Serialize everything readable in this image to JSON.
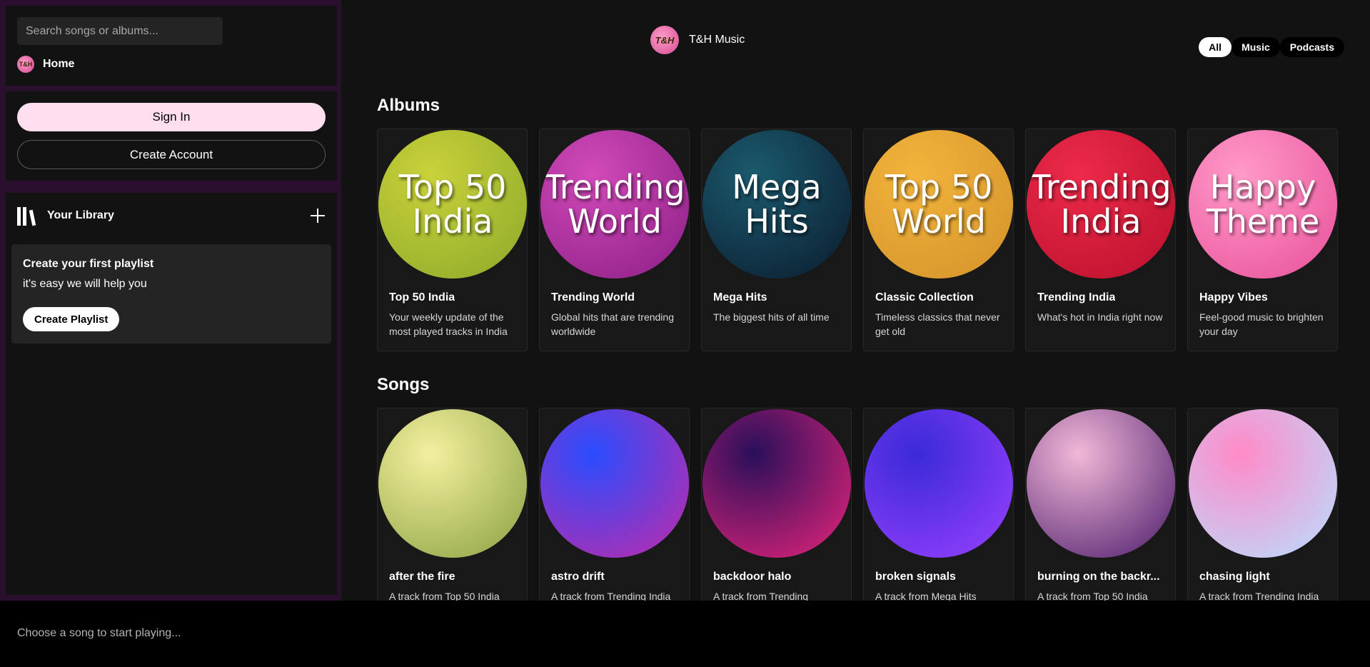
{
  "sidebar": {
    "search": {
      "placeholder": "Search songs or albums..."
    },
    "home": {
      "logo_text": "T&H",
      "label": "Home"
    },
    "auth": {
      "sign_in": "Sign In",
      "create_account": "Create Account"
    },
    "library": {
      "title": "Your Library",
      "card_title": "Create your first playlist",
      "card_sub": "it's easy we will help you",
      "create_playlist": "Create Playlist"
    }
  },
  "header": {
    "brand_logo_text": "T&H",
    "brand_name": "T&H Music",
    "filters": [
      "All",
      "Music",
      "Podcasts"
    ],
    "active_filter": "All"
  },
  "albums": {
    "title": "Albums",
    "items": [
      {
        "cover_text": "Top 50 India",
        "title": "Top 50 India",
        "desc": "Your weekly update of the most played tracks in India",
        "colors": [
          "#c9d23a",
          "#8ea82a"
        ]
      },
      {
        "cover_text": "Trending World",
        "title": "Trending World",
        "desc": "Global hits that are trending worldwide",
        "colors": [
          "#d24ab8",
          "#8a1e86"
        ]
      },
      {
        "cover_text": "Mega Hits",
        "title": "Mega Hits",
        "desc": "The biggest hits of all time",
        "colors": [
          "#1b5a6e",
          "#0b1a2c"
        ]
      },
      {
        "cover_text": "Top 50 World",
        "title": "Classic Collection",
        "desc": "Timeless classics that never get old",
        "colors": [
          "#f2b43c",
          "#d4922a"
        ]
      },
      {
        "cover_text": "Trending India",
        "title": "Trending India",
        "desc": "What's hot in India right now",
        "colors": [
          "#ee2a4a",
          "#b8102c"
        ]
      },
      {
        "cover_text": "Happy Theme",
        "title": "Happy Vibes",
        "desc": "Feel-good music to brighten your day",
        "colors": [
          "#ff9ac8",
          "#e8509a"
        ]
      }
    ]
  },
  "songs": {
    "title": "Songs",
    "items": [
      {
        "title": "after the fire",
        "desc": "A track from Top 50 India",
        "colors": [
          "#f4f0a0",
          "#8aa040"
        ]
      },
      {
        "title": "astro drift",
        "desc": "A track from Trending India",
        "colors": [
          "#2a4cff",
          "#c22aa8"
        ]
      },
      {
        "title": "backdoor halo",
        "desc": "A track from Trending",
        "colors": [
          "#2a0f5a",
          "#e8247a"
        ]
      },
      {
        "title": "broken signals",
        "desc": "A track from Mega Hits",
        "colors": [
          "#3a2ad8",
          "#9a40ff"
        ]
      },
      {
        "title": "burning on the backr...",
        "desc": "A track from Top 50 India",
        "colors": [
          "#f2b8d8",
          "#4a1a6a"
        ]
      },
      {
        "title": "chasing light",
        "desc": "A track from Trending India",
        "colors": [
          "#ff8ac8",
          "#b8e0ff"
        ]
      }
    ]
  },
  "player": {
    "status": "Choose a song to start playing..."
  }
}
